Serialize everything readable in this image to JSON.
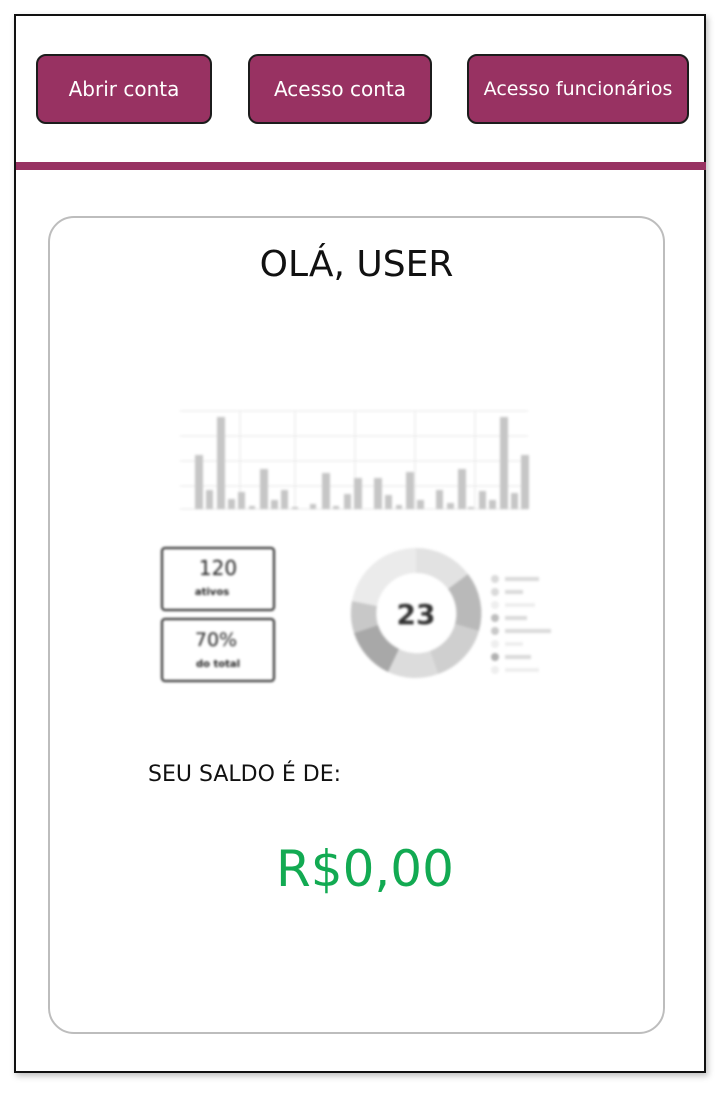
{
  "nav": {
    "open_account": "Abrir conta",
    "access_account": "Acesso conta",
    "employee_access": "Acesso funcionários"
  },
  "card": {
    "greeting": "OLÁ, USER",
    "balance_label": "SEU SALDO É DE:",
    "balance_value": "R$0,00"
  },
  "dashboard_image": {
    "stat1_value": "120",
    "stat1_label": "ativos",
    "stat2_value": "70%",
    "stat2_label": "do total",
    "donut_value": "23"
  },
  "colors": {
    "brand": "#983262",
    "balance": "#12aa52"
  }
}
